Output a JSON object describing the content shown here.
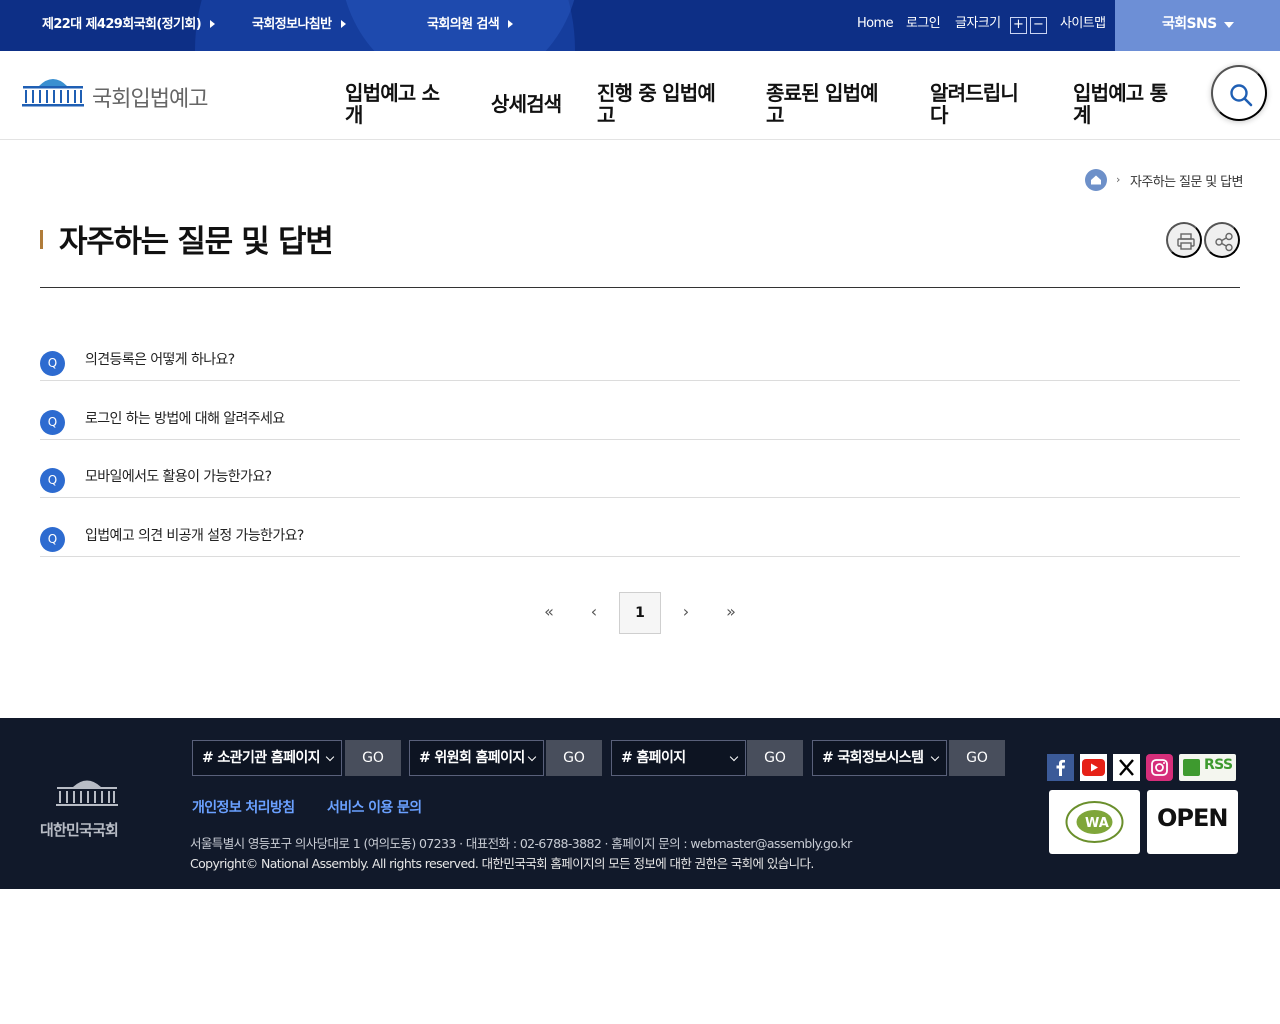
{
  "topbar": {
    "links": [
      {
        "label": "제22대 제429회국회(정기회)"
      },
      {
        "label": "국회정보나침반"
      },
      {
        "label": "국회의원 검색"
      }
    ],
    "home": "Home",
    "login": "로그인",
    "font_size_label": "글자크기",
    "font_plus": "+",
    "font_minus": "−",
    "sitemap": "사이트맵",
    "sns": "국회SNS"
  },
  "header": {
    "logo_text": "국회입법예고",
    "gnb": [
      {
        "line1": "입법예고 소",
        "line2": "개"
      },
      {
        "line1": "상세검색",
        "line2": ""
      },
      {
        "line1": "진행 중 입법예",
        "line2": "고"
      },
      {
        "line1": "종료된 입법예",
        "line2": "고"
      },
      {
        "line1": "알려드립니",
        "line2": "다"
      },
      {
        "line1": "입법예고 통",
        "line2": "계"
      }
    ]
  },
  "breadcrumb": {
    "current": "자주하는 질문 및 답변"
  },
  "page": {
    "title": "자주하는 질문 및 답변"
  },
  "faq": {
    "badge": "Q",
    "items": [
      {
        "question": "의견등록은 어떻게 하나요?"
      },
      {
        "question": "로그인 하는 방법에 대해 알려주세요"
      },
      {
        "question": "모바일에서도 활용이 가능한가요?"
      },
      {
        "question": "입법예고 의견 비공개 설정 가능한가요?"
      }
    ]
  },
  "pagination": {
    "first": "«",
    "prev": "‹",
    "current": "1",
    "next": "›",
    "last": "»"
  },
  "footer": {
    "logo_text": "대한민국국회",
    "selects": [
      {
        "label": "# 소관기관 홈페이지",
        "go": "GO"
      },
      {
        "label": "# 위원회 홈페이지",
        "go": "GO"
      },
      {
        "label": "# 홈페이지",
        "go": "GO"
      },
      {
        "label": "# 국회정보시스템",
        "go": "GO"
      }
    ],
    "privacy": "개인정보 처리방침",
    "inquiry": "서비스 이용 문의",
    "address": "서울특별시 영등포구 의사당대로 1 (여의도동) 07233  · 대표전화 : 02-6788-3882  · 홈페이지 문의 : webmaster@assembly.go.kr",
    "copyright": "Copyright© National Assembly. All rights reserved. 대한민국국회 홈페이지의 모든 정보에 대한 권한은 국회에 있습니다.",
    "rss": "RSS",
    "cert_open": "OPEN",
    "cert_wa": "WA"
  },
  "colors": {
    "topbar": "#0d2f86",
    "accent": "#2d6bd0",
    "footer": "#11192a",
    "title_bar": "#b07c3a"
  }
}
